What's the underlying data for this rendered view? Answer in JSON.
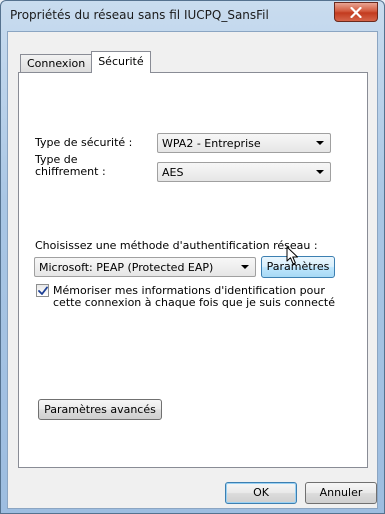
{
  "window": {
    "title": "Propriétés du réseau sans fil IUCPQ_SansFil"
  },
  "tabs": [
    {
      "label": "Connexion"
    },
    {
      "label": "Sécurité"
    }
  ],
  "security": {
    "type_label": "Type de sécurité :",
    "type_value": "WPA2 - Entreprise",
    "encryption_label_line1": "Type de",
    "encryption_label_line2": "chiffrement :",
    "encryption_value": "AES",
    "auth_label": "Choisissez une méthode d'authentification réseau :",
    "auth_value": "Microsoft: PEAP (Protected EAP)",
    "settings_button": "Paramètres",
    "remember_line1": "Mémoriser mes informations d'identification pour",
    "remember_line2": "cette connexion à chaque fois que je suis connecté",
    "remember_checked": true,
    "advanced_button": "Paramètres avancés"
  },
  "footer": {
    "ok_label": "OK",
    "cancel_label": "Annuler"
  },
  "icons": {
    "close": "close-icon",
    "dropdown": "chevron-down-icon",
    "check": "checkmark-icon",
    "cursor": "mouse-pointer-icon"
  },
  "colors": {
    "titlebar": "#a9c6e4",
    "close_button": "#c33b1f",
    "hover_button": "#bee6fd",
    "panel": "#ffffff",
    "dialog": "#f0f0f0"
  }
}
